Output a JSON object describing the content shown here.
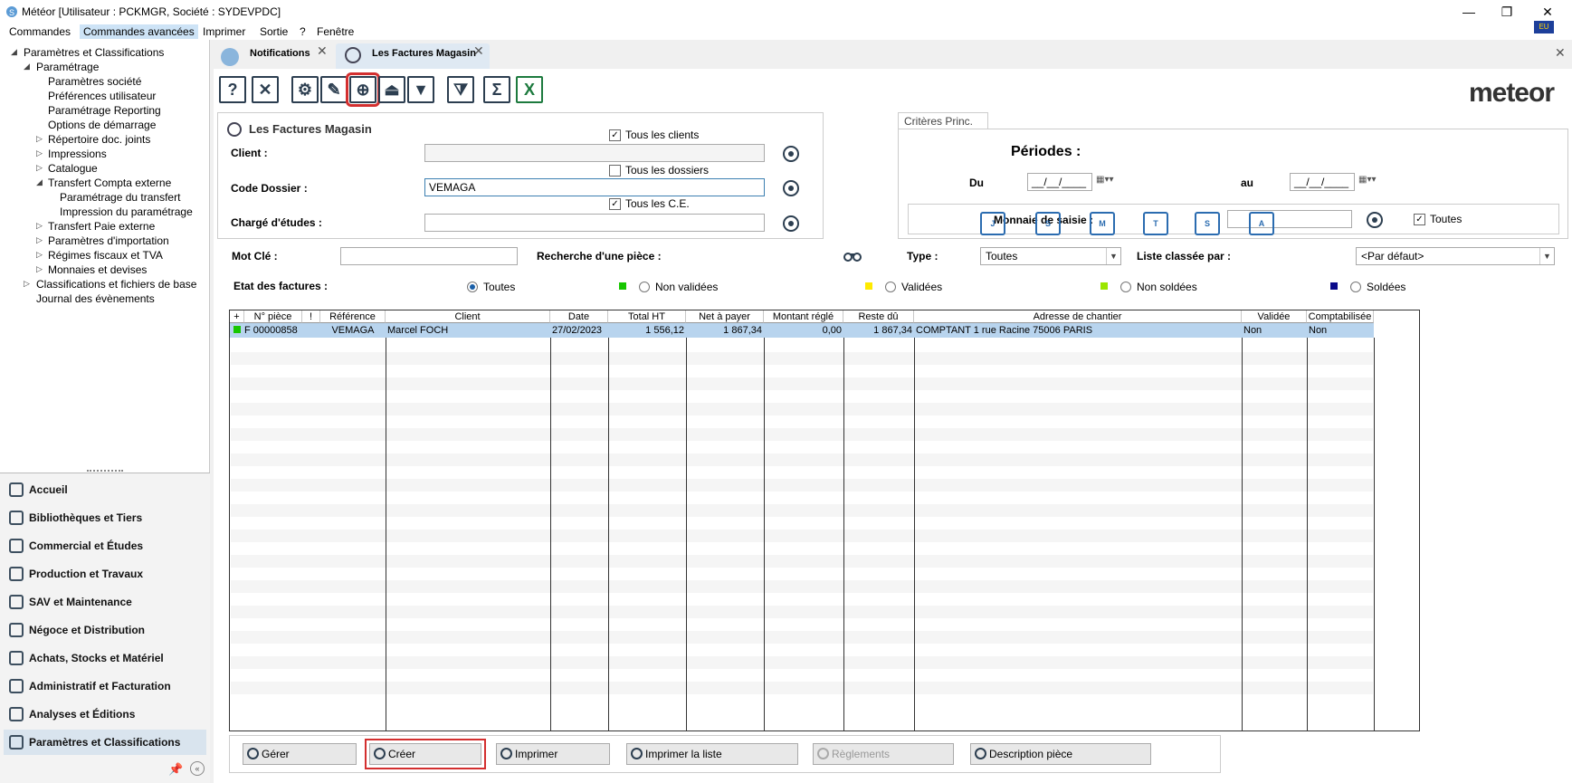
{
  "window": {
    "title": "Météor [Utilisateur : PCKMGR, Société : SYDEVPDC]",
    "minimize": "—",
    "restore": "❐",
    "close": "✕"
  },
  "menu": [
    "Commandes",
    "Commandes avancées",
    "Imprimer",
    "Sortie",
    "?",
    "Fenêtre"
  ],
  "tree": [
    {
      "label": "Paramètres et Classifications",
      "level": 0,
      "arrow": "◢"
    },
    {
      "label": "Paramétrage",
      "level": 1,
      "arrow": "◢"
    },
    {
      "label": "Paramètres société",
      "level": 2
    },
    {
      "label": "Préférences utilisateur",
      "level": 2
    },
    {
      "label": "Paramétrage Reporting",
      "level": 2
    },
    {
      "label": "Options de démarrage",
      "level": 2
    },
    {
      "label": "Répertoire doc. joints",
      "level": 2,
      "arrow": "▷"
    },
    {
      "label": "Impressions",
      "level": 2,
      "arrow": "▷"
    },
    {
      "label": "Catalogue",
      "level": 2,
      "arrow": "▷"
    },
    {
      "label": "Transfert Compta externe",
      "level": 2,
      "arrow": "◢"
    },
    {
      "label": "Paramétrage du transfert",
      "level": 3
    },
    {
      "label": "Impression du paramétrage",
      "level": 3
    },
    {
      "label": "Transfert Paie externe",
      "level": 2,
      "arrow": "▷"
    },
    {
      "label": "Paramètres d'importation",
      "level": 2,
      "arrow": "▷"
    },
    {
      "label": "Régimes fiscaux et TVA",
      "level": 2,
      "arrow": "▷"
    },
    {
      "label": "Monnaies et devises",
      "level": 2,
      "arrow": "▷"
    },
    {
      "label": "Classifications et fichiers de base",
      "level": 1,
      "arrow": "▷"
    },
    {
      "label": "Journal des évènements",
      "level": 1
    }
  ],
  "nav": [
    {
      "label": "Accueil",
      "icon": "home-icon"
    },
    {
      "label": "Bibliothèques et Tiers",
      "icon": "library-icon"
    },
    {
      "label": "Commercial et Études",
      "icon": "pen-ruler-icon"
    },
    {
      "label": "Production et Travaux",
      "icon": "worker-icon"
    },
    {
      "label": "SAV et Maintenance",
      "icon": "wrench-icon"
    },
    {
      "label": "Négoce et Distribution",
      "icon": "trade-icon"
    },
    {
      "label": "Achats, Stocks et Matériel",
      "icon": "cart-icon"
    },
    {
      "label": "Administratif et Facturation",
      "icon": "invoice-icon"
    },
    {
      "label": "Analyses et Éditions",
      "icon": "report-icon"
    },
    {
      "label": "Paramètres et Classifications",
      "icon": "settings-icon"
    }
  ],
  "tabs": [
    {
      "label": "Notifications",
      "active": false
    },
    {
      "label": "Les Factures Magasin",
      "active": true
    }
  ],
  "toolbar": [
    {
      "name": "help-button",
      "glyph": "?"
    },
    {
      "name": "delete-button",
      "glyph": "✕"
    },
    {
      "name": "settings-button",
      "glyph": "⚙"
    },
    {
      "name": "edit-button",
      "glyph": "✎"
    },
    {
      "name": "add-button",
      "glyph": "⊕"
    },
    {
      "name": "collapse-button",
      "glyph": "⏏"
    },
    {
      "name": "expand-button",
      "glyph": "▼"
    },
    {
      "name": "filter-button",
      "glyph": "⧩"
    },
    {
      "name": "sum-button",
      "glyph": "Σ"
    },
    {
      "name": "excel-button",
      "glyph": "X"
    }
  ],
  "logo": "meteor",
  "form": {
    "title": "Les Factures Magasin",
    "client_label": "Client :",
    "client_value": "",
    "all_clients": "Tous les clients",
    "dossier_label": "Code Dossier :",
    "dossier_value": "VEMAGA",
    "all_dossiers": "Tous les dossiers",
    "ce_label": "Chargé d'études :",
    "ce_value": "",
    "all_ce": "Tous les C.E."
  },
  "criteria": {
    "tab": "Critères Princ.",
    "periods": "Périodes :",
    "period_icons": [
      "J",
      "S",
      "M",
      "T",
      "S",
      "A"
    ],
    "from_label": "Du",
    "from_value": "__/__/____",
    "to_label": "au",
    "to_value": "__/__/____",
    "currency_label": "Monnaie de saisie :",
    "currency_value": "",
    "all_label": "Toutes"
  },
  "filters": {
    "keyword_label": "Mot Clé :",
    "keyword_value": "",
    "search_label": "Recherche d'une pièce :",
    "type_label": "Type :",
    "type_value": "Toutes",
    "order_label": "Liste classée par :",
    "order_value": "<Par défaut>",
    "state_label": "Etat des factures :",
    "states": [
      {
        "label": "Toutes",
        "selected": true
      },
      {
        "label": "Non validées",
        "color": "#17c600"
      },
      {
        "label": "Validées",
        "color": "#ffea00"
      },
      {
        "label": "Non soldées",
        "color": "#9be600"
      },
      {
        "label": "Soldées",
        "color": "#0a0a8a"
      }
    ]
  },
  "grid": {
    "columns": [
      "+",
      "N° pièce",
      "!",
      "Référence",
      "Client",
      "Date",
      "Total HT",
      "Net à payer",
      "Montant réglé",
      "Reste dû",
      "Adresse de chantier",
      "Validée",
      "Comptabilisée"
    ],
    "rows": [
      {
        "status_color": "#17c600",
        "piece": "F 00000858",
        "flag": "",
        "reference": "VEMAGA",
        "client": "Marcel FOCH",
        "date": "27/02/2023",
        "total_ht": "1 556,12",
        "net": "1 867,34",
        "paid": "0,00",
        "due": "1 867,34",
        "address": "COMPTANT 1 rue Racine  75006 PARIS",
        "validated": "Non",
        "accounted": "Non"
      }
    ]
  },
  "buttons": [
    {
      "label": "Gérer",
      "name": "manage-button"
    },
    {
      "label": "Créer",
      "name": "create-button"
    },
    {
      "label": "Imprimer",
      "name": "print-button"
    },
    {
      "label": "Imprimer la liste",
      "name": "print-list-button"
    },
    {
      "label": "Règlements",
      "name": "payments-button",
      "disabled": true
    },
    {
      "label": "Description pièce",
      "name": "piece-description-button"
    }
  ],
  "flag_label": "EU"
}
